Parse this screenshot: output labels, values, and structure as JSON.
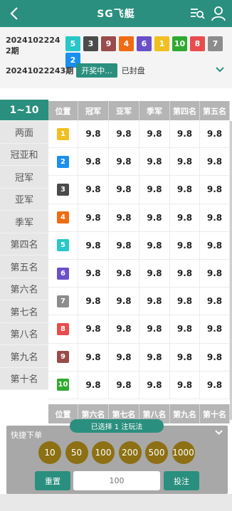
{
  "header": {
    "title": "SG飞艇"
  },
  "draw": {
    "last_period": "20241022242期",
    "results": [
      {
        "n": "5",
        "color": "#28c7c9"
      },
      {
        "n": "3",
        "color": "#4b4b4b"
      },
      {
        "n": "9",
        "color": "#9b4b4b"
      },
      {
        "n": "4",
        "color": "#f06c14"
      },
      {
        "n": "6",
        "color": "#6b4fc8"
      },
      {
        "n": "1",
        "color": "#f0c020"
      },
      {
        "n": "10",
        "color": "#2faa2f"
      },
      {
        "n": "8",
        "color": "#e84d4d"
      },
      {
        "n": "7",
        "color": "#8c8c8c"
      },
      {
        "n": "2",
        "color": "#1a8ff0"
      }
    ],
    "next_period": "20241022243期",
    "status": "开奖中...",
    "closed": "已封盘"
  },
  "categories": [
    "1~10",
    "两面",
    "冠亚和",
    "冠军",
    "亚军",
    "季军",
    "第四名",
    "第五名",
    "第六名",
    "第七名",
    "第八名",
    "第九名",
    "第十名"
  ],
  "table": {
    "headers": [
      "位置",
      "冠军",
      "亚军",
      "季军",
      "第四名",
      "第五名"
    ],
    "headers2": [
      "位置",
      "第六名",
      "第七名",
      "第八名",
      "第九名",
      "第十名"
    ],
    "rows": [
      {
        "pos": "1",
        "color": "#f0c020",
        "odds": [
          "9.8",
          "9.8",
          "9.8",
          "9.8",
          "9.8"
        ]
      },
      {
        "pos": "2",
        "color": "#1a8ff0",
        "odds": [
          "9.8",
          "9.8",
          "9.8",
          "9.8",
          "9.8"
        ]
      },
      {
        "pos": "3",
        "color": "#4b4b4b",
        "odds": [
          "9.8",
          "9.8",
          "9.8",
          "9.8",
          "9.8"
        ]
      },
      {
        "pos": "4",
        "color": "#f06c14",
        "odds": [
          "9.8",
          "9.8",
          "9.8",
          "9.8",
          "9.8"
        ]
      },
      {
        "pos": "5",
        "color": "#28c7c9",
        "odds": [
          "9.8",
          "9.8",
          "9.8",
          "9.8",
          "9.8"
        ]
      },
      {
        "pos": "6",
        "color": "#6b4fc8",
        "odds": [
          "9.8",
          "9.8",
          "9.8",
          "9.8",
          "9.8"
        ]
      },
      {
        "pos": "7",
        "color": "#8c8c8c",
        "odds": [
          "9.8",
          "9.8",
          "9.8",
          "9.8",
          "9.8"
        ]
      },
      {
        "pos": "8",
        "color": "#e84d4d",
        "odds": [
          "9.8",
          "9.8",
          "9.8",
          "9.8",
          "9.8"
        ]
      },
      {
        "pos": "9",
        "color": "#9b4b4b",
        "odds": [
          "9.8",
          "9.8",
          "9.8",
          "9.8",
          "9.8"
        ]
      },
      {
        "pos": "10",
        "color": "#2faa2f",
        "odds": [
          "9.8",
          "9.8",
          "9.8",
          "9.8",
          "9.8"
        ]
      }
    ]
  },
  "quick_bet": {
    "label": "快捷下单",
    "selected": "已选择 1 注玩法",
    "chips": [
      "10",
      "50",
      "100",
      "200",
      "500",
      "1000"
    ],
    "reset": "重置",
    "amount": "100",
    "submit": "投注"
  },
  "colors": {
    "accent": "#2a8f7e",
    "chip": "#8c7013"
  }
}
